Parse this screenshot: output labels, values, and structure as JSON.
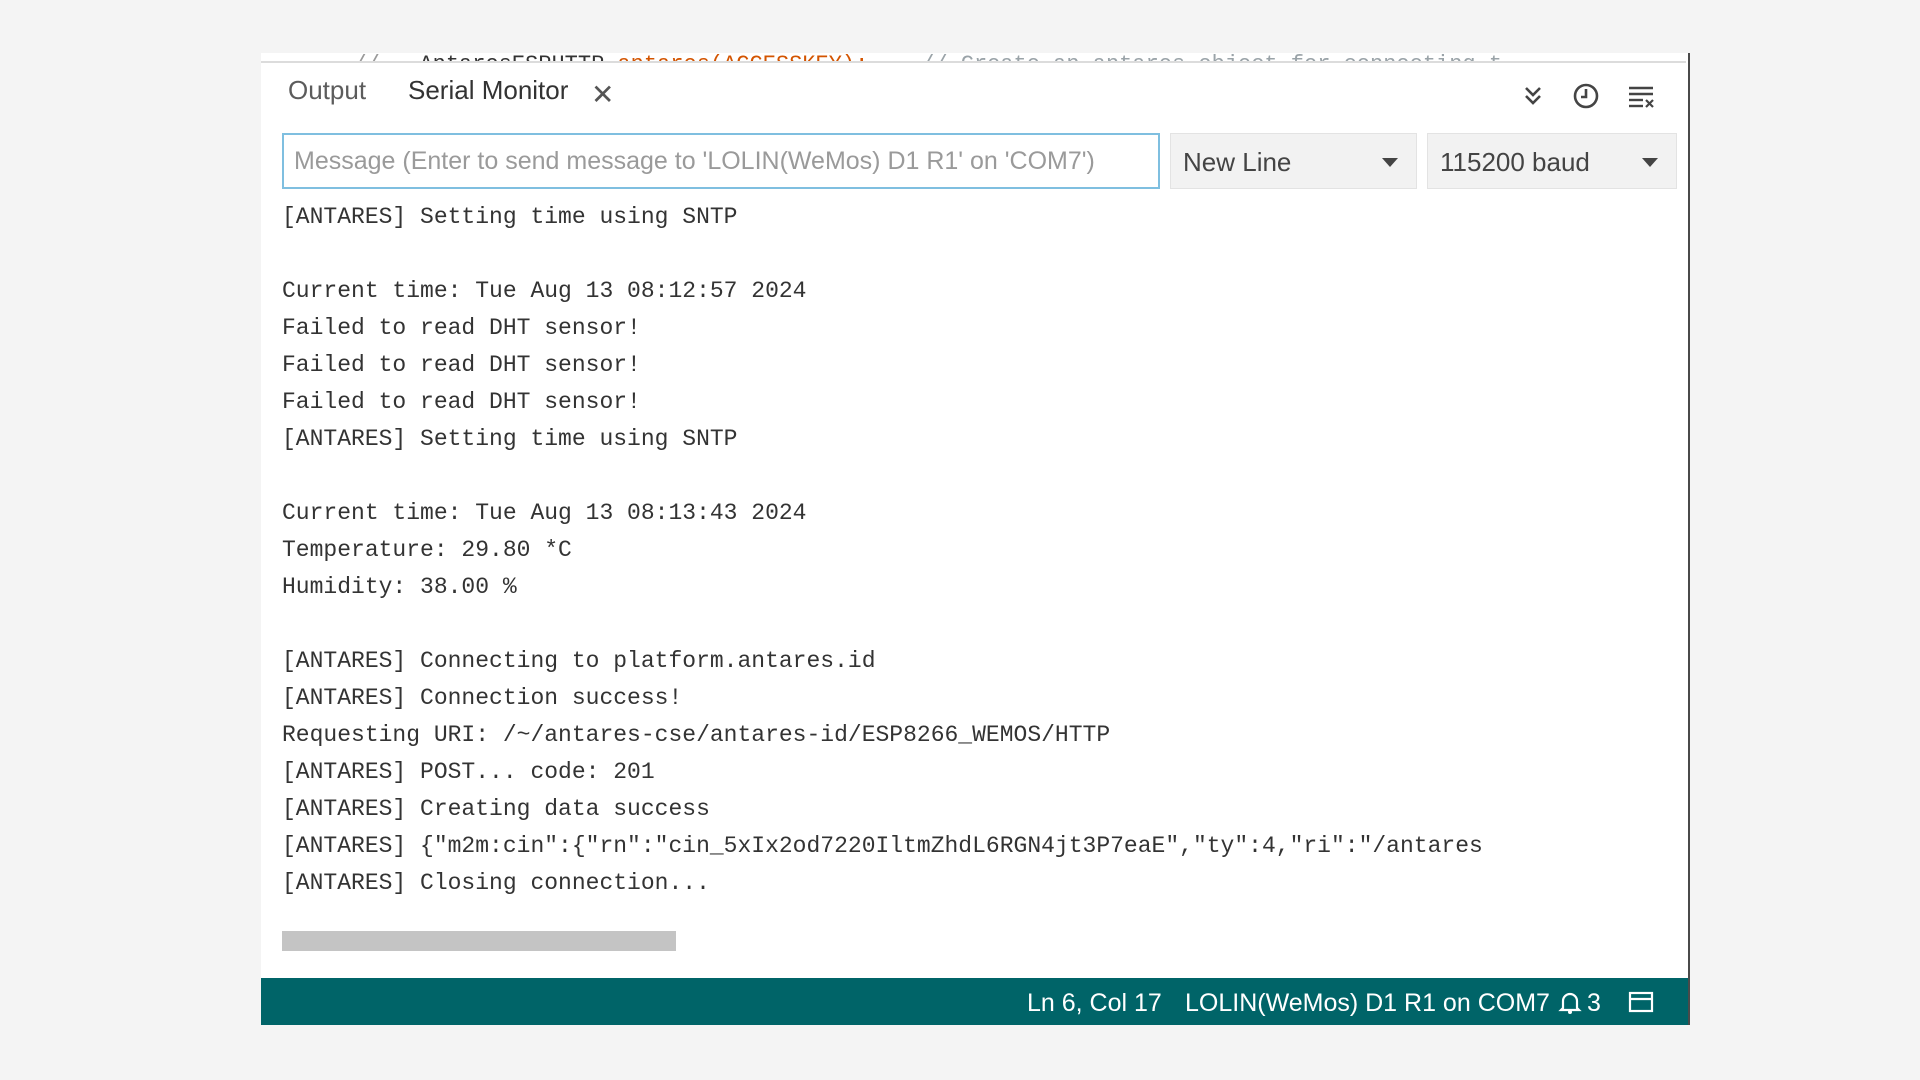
{
  "editor_snippet": {
    "left": "//",
    "class_name": "AntaresESPHTTP",
    "object": "antares(ACCESSKEY);",
    "comment": "// Create an antares object for connecting t"
  },
  "tabs": [
    {
      "label": "Output",
      "active": false
    },
    {
      "label": "Serial Monitor",
      "active": true,
      "close_icon": "close-icon"
    }
  ],
  "toolbar": {
    "collapse_icon": "double-chevron-down-icon",
    "timestamp_icon": "clock-icon",
    "clear_icon": "clear-output-icon"
  },
  "message_input": {
    "value": "",
    "placeholder": "Message (Enter to send message to 'LOLIN(WeMos) D1 R1' on 'COM7')"
  },
  "line_ending": {
    "selected": "New Line"
  },
  "baud_rate": {
    "selected": "115200 baud"
  },
  "console_lines": [
    "[ANTARES] Setting time using SNTP",
    "",
    "Current time: Tue Aug 13 08:12:57 2024",
    "Failed to read DHT sensor!",
    "Failed to read DHT sensor!",
    "Failed to read DHT sensor!",
    "[ANTARES] Setting time using SNTP",
    "",
    "Current time: Tue Aug 13 08:13:43 2024",
    "Temperature: 29.80 *C",
    "Humidity: 38.00 %",
    "",
    "[ANTARES] Connecting to platform.antares.id",
    "[ANTARES] Connection success!",
    "Requesting URI: /~/antares-cse/antares-id/ESP8266_WEMOS/HTTP",
    "[ANTARES] POST... code: 201",
    "[ANTARES] Creating data success",
    "[ANTARES] {\"m2m:cin\":{\"rn\":\"cin_5xIx2od7220IltmZhdL6RGN4jt3P7eaE\",\"ty\":4,\"ri\":\"/antares",
    "[ANTARES] Closing connection..."
  ],
  "statusbar": {
    "cursor": "Ln 6, Col 17",
    "board": "LOLIN(WeMos) D1 R1 on COM7",
    "notifications": "3",
    "notification_icon": "bell-icon",
    "panel_icon": "toggle-panel-icon"
  },
  "colors": {
    "statusbar": "#006468",
    "input_border": "#7fbfe0",
    "background": "#f4f4f4"
  }
}
